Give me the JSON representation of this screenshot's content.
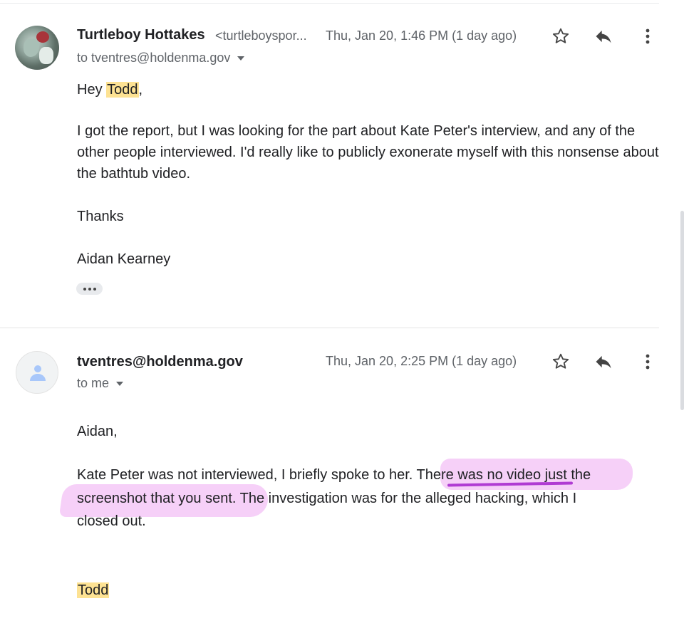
{
  "messages": [
    {
      "sender_name": "Turtleboy Hottakes",
      "sender_email": "<turtleboyspor...",
      "date": "Thu, Jan 20, 1:46 PM (1 day ago)",
      "to_line": "to tventres@holdenma.gov",
      "greeting_prefix": "Hey ",
      "greeting_name": "Todd",
      "greeting_suffix": ",",
      "paragraph_lines": [
        "I got the report, but I was looking for the part about Kate Peter's interview, and any of the",
        "other people interviewed. I'd really like to publicly exonerate myself with this nonsense about",
        "the bathtub video."
      ],
      "closing": "Thanks",
      "signature": "Aidan Kearney",
      "avatar_icon": "profile-photo"
    },
    {
      "sender_name": "tventres@holdenma.gov",
      "date": "Thu, Jan 20, 2:25 PM (1 day ago)",
      "to_line": "to me",
      "greeting": "Aidan,",
      "paragraph_lines": [
        "Kate Peter was not interviewed, I briefly spoke to her. There was no video just the",
        "screenshot that you sent. The investigation was for the alleged hacking, which I",
        "closed out."
      ],
      "signature": "Todd",
      "avatar_icon": "person-icon"
    }
  ],
  "actions": {
    "star_icon": "star-outline-icon",
    "reply_icon": "reply-arrow-icon",
    "more_icon": "more-vert-icon",
    "show_trimmed_icon": "ellipsis-icon"
  },
  "colors": {
    "highlight_yellow": "#fde293",
    "marker_pink": "#ec96f0",
    "marker_underline": "#b03bd3"
  }
}
